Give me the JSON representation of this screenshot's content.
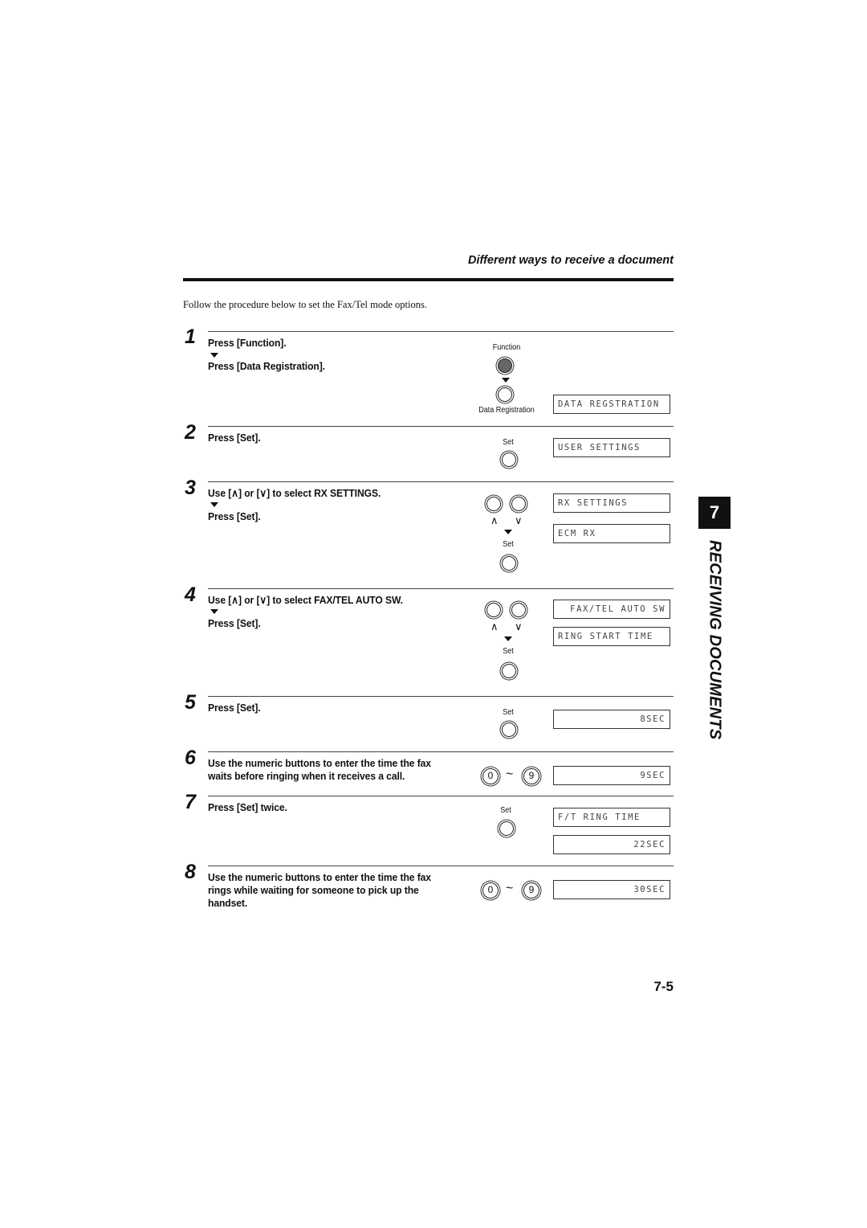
{
  "header": {
    "section_title": "Different ways to receive a document",
    "intro": "Follow the procedure below to set the Fax/Tel mode options."
  },
  "steps": [
    {
      "number": "1",
      "lines": [
        "Press [Function].",
        "Press [Data Registration]."
      ],
      "buttons": {
        "function_label": "Function",
        "data_registration_label": "Data Registration"
      },
      "displays": [
        "DATA REGSTRATION"
      ]
    },
    {
      "number": "2",
      "lines": [
        "Press [Set]."
      ],
      "buttons": {
        "set_label": "Set"
      },
      "displays": [
        "USER SETTINGS"
      ]
    },
    {
      "number": "3",
      "lines": [
        "Use [∧] or [∨] to select RX SETTINGS.",
        "Press [Set]."
      ],
      "buttons": {
        "up_label": "∧",
        "down_label": "∨",
        "set_label": "Set"
      },
      "displays": [
        "RX SETTINGS",
        "ECM RX"
      ]
    },
    {
      "number": "4",
      "lines": [
        "Use [∧] or [∨] to select FAX/TEL AUTO SW.",
        "Press [Set]."
      ],
      "buttons": {
        "up_label": "∧",
        "down_label": "∨",
        "set_label": "Set"
      },
      "displays": [
        "FAX/TEL AUTO SW",
        "RING START TIME"
      ]
    },
    {
      "number": "5",
      "lines": [
        "Press [Set]."
      ],
      "buttons": {
        "set_label": "Set"
      },
      "displays": [
        "8SEC"
      ]
    },
    {
      "number": "6",
      "lines": [
        "Use the numeric buttons to enter the time the fax",
        "waits before ringing when it receives a call."
      ],
      "buttons": {
        "num_start": "0",
        "tilde": "~",
        "num_end": "9"
      },
      "displays": [
        "9SEC"
      ]
    },
    {
      "number": "7",
      "lines": [
        "Press [Set] twice."
      ],
      "buttons": {
        "set_label": "Set"
      },
      "displays": [
        "F/T RING TIME",
        "22SEC"
      ]
    },
    {
      "number": "8",
      "lines": [
        "Use the numeric buttons to enter the time the fax",
        "rings while waiting for someone to pick up the",
        "handset."
      ],
      "buttons": {
        "num_start": "0",
        "tilde": "~",
        "num_end": "9"
      },
      "displays": [
        "30SEC"
      ]
    }
  ],
  "side_tab": {
    "chapter_number": "7",
    "chapter_title": "RECEIVING DOCUMENTS"
  },
  "footer": {
    "page_number": "7-5"
  }
}
